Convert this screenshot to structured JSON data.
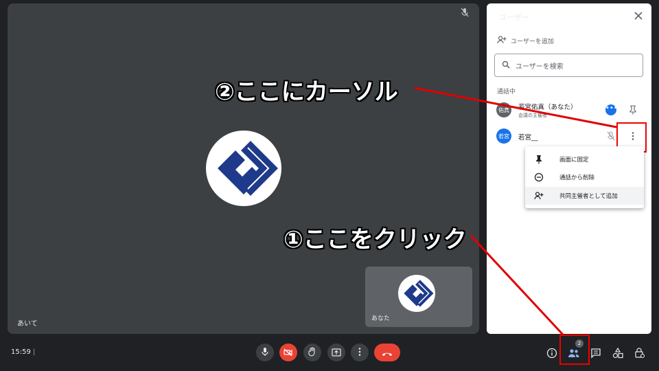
{
  "stage": {
    "participant_name": "あいて",
    "self_name": "あなた"
  },
  "panel": {
    "title": "ユーザー",
    "add_user": "ユーザーを追加",
    "search_placeholder": "ユーザーを検索",
    "section_label": "通話中",
    "participants": [
      {
        "avatar_text": "佑真",
        "avatar_color": "#5f6368",
        "name": "若宮佑真（あなた）",
        "role": "会議の主催者"
      },
      {
        "avatar_text": "若宮",
        "avatar_color": "#1a73e8",
        "name": "若宮__",
        "role": ""
      }
    ]
  },
  "menu": {
    "items": [
      "画面に固定",
      "通話から削除",
      "共同主催者として追加"
    ]
  },
  "annotations": {
    "step2": "②ここにカーソル",
    "step1": "①ここをクリック",
    "accent_color": "#e00000"
  },
  "controls": {
    "time": "15:59",
    "separator": "|",
    "participants_count": "2"
  },
  "icons": {
    "mic": "mic-icon",
    "camera_off": "camera-off-icon",
    "hand": "raise-hand-icon",
    "present": "present-icon",
    "more": "more-vert-icon",
    "hangup": "hangup-icon",
    "info": "info-icon",
    "people": "people-icon",
    "chat": "chat-icon",
    "activities": "activities-icon",
    "lock": "host-controls-icon"
  }
}
